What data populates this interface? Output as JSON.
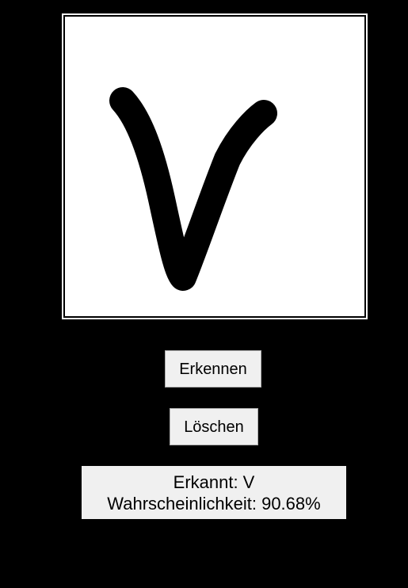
{
  "buttons": {
    "recognize_label": "Erkennen",
    "clear_label": "Löschen"
  },
  "result": {
    "line1": "Erkannt: V",
    "line2": "Wahrscheinlichkeit: 90.68%"
  },
  "colors": {
    "background": "#000000",
    "canvas": "#ffffff",
    "stroke": "#000000",
    "button_face": "#f0f0f0"
  }
}
